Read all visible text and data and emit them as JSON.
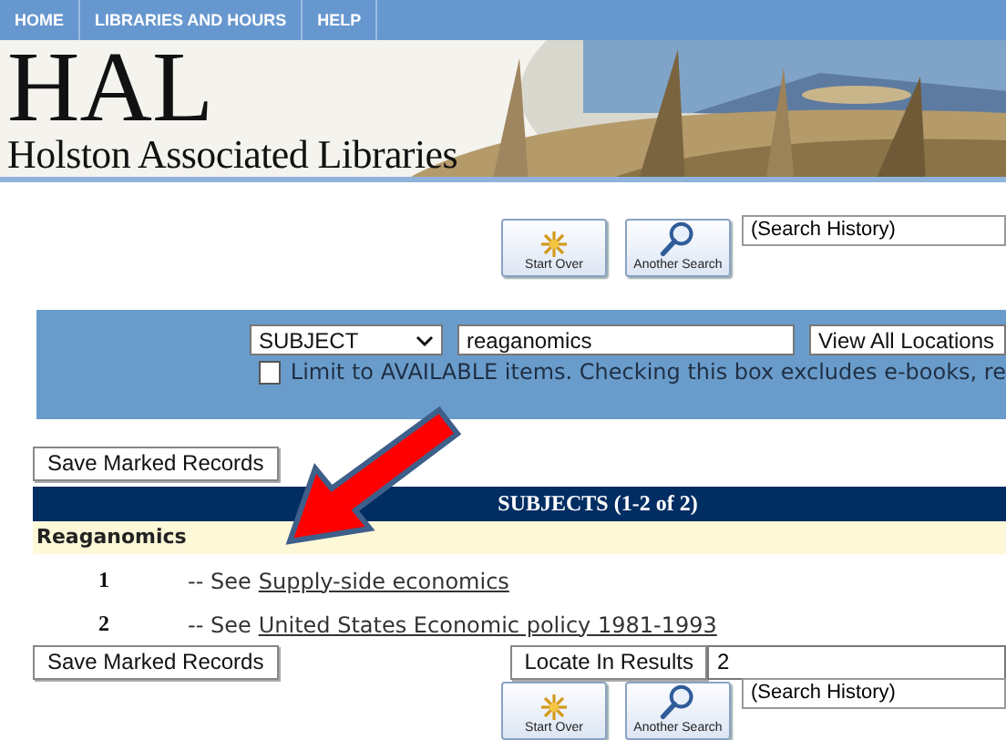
{
  "nav": [
    "HOME",
    "LIBRARIES AND HOURS",
    "HELP"
  ],
  "banner": {
    "title": "HAL",
    "subtitle": "Holston Associated Libraries"
  },
  "toolbar_top": {
    "buttons": [
      {
        "kind": "start-over",
        "label": "Start Over"
      },
      {
        "kind": "search",
        "label": "Another Search"
      }
    ],
    "history": "(Search History)"
  },
  "search": {
    "field_type": "SUBJECT",
    "query": "reaganomics",
    "location": "View All Locations",
    "limit": {
      "checked": false,
      "label": "Limit to AVAILABLE items. Checking this box excludes e-books, re"
    }
  },
  "save_button": "Save Marked Records",
  "results": {
    "heading": "SUBJECTS (1-2 of 2)",
    "group": "Reaganomics",
    "rows": [
      {
        "number": "1",
        "prefix": "-- See",
        "link": "Supply-side economics"
      },
      {
        "number": "2",
        "prefix": "-- See",
        "link": "United States Economic policy 1981-1993"
      }
    ]
  },
  "bottom": {
    "save_button": "Save Marked Records",
    "locate_button": "Locate In Results",
    "locate_value": "2",
    "toolbar": {
      "buttons": [
        {
          "kind": "start-over",
          "label": "Start Over"
        },
        {
          "kind": "search",
          "label": "Another Search"
        }
      ],
      "history": "(Search History)"
    }
  }
}
